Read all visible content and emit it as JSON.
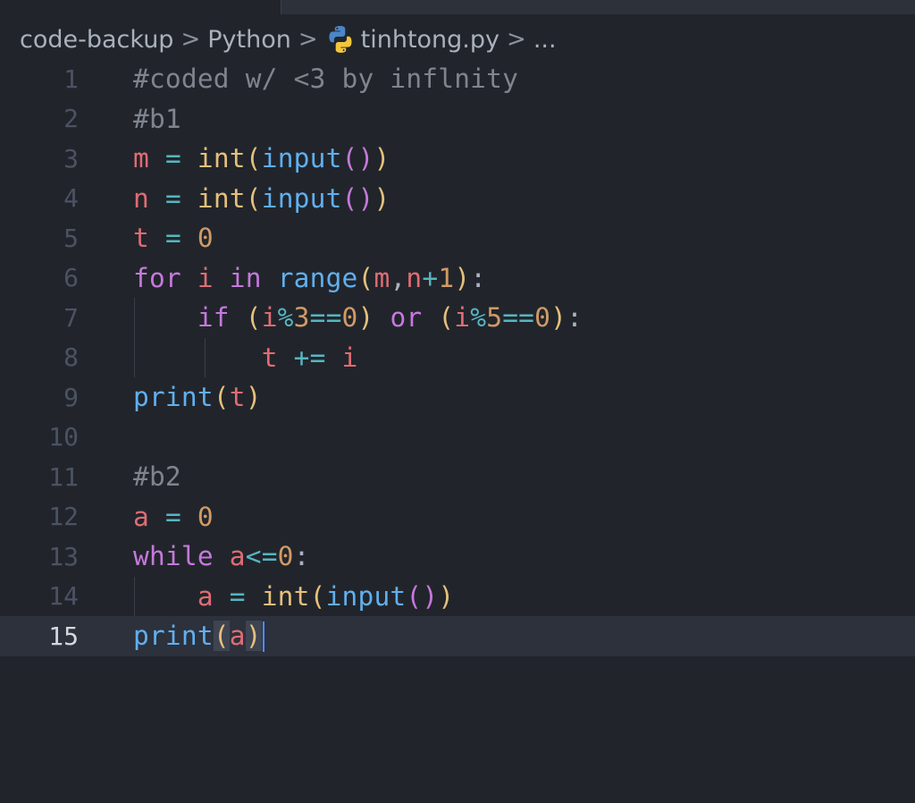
{
  "breadcrumb": {
    "items": [
      "code-backup",
      "Python",
      "tinhtong.py",
      "..."
    ],
    "separator": ">"
  },
  "editor": {
    "active_line": 15,
    "line_numbers": [
      "1",
      "2",
      "3",
      "4",
      "5",
      "6",
      "7",
      "8",
      "9",
      "10",
      "11",
      "12",
      "13",
      "14",
      "15"
    ],
    "lines": [
      "#coded w/ <3 by inflnity",
      "#b1",
      "m = int(input())",
      "n = int(input())",
      "t = 0",
      "for i in range(m,n+1):",
      "    if (i%3==0) or (i%5==0):",
      "        t += i",
      "print(t)",
      "",
      "#b2",
      "a = 0",
      "while a<=0:",
      "    a = int(input())",
      "print(a)"
    ]
  },
  "colors": {
    "background": "#21252b",
    "comment": "#7f848e",
    "variable": "#e06c75",
    "operator": "#56b6c2",
    "number": "#d19a66",
    "keyword": "#c678dd",
    "function": "#61afef",
    "builtin": "#e5c07b",
    "cursor": "#528bff"
  },
  "icons": {
    "file_type": "python-icon"
  }
}
